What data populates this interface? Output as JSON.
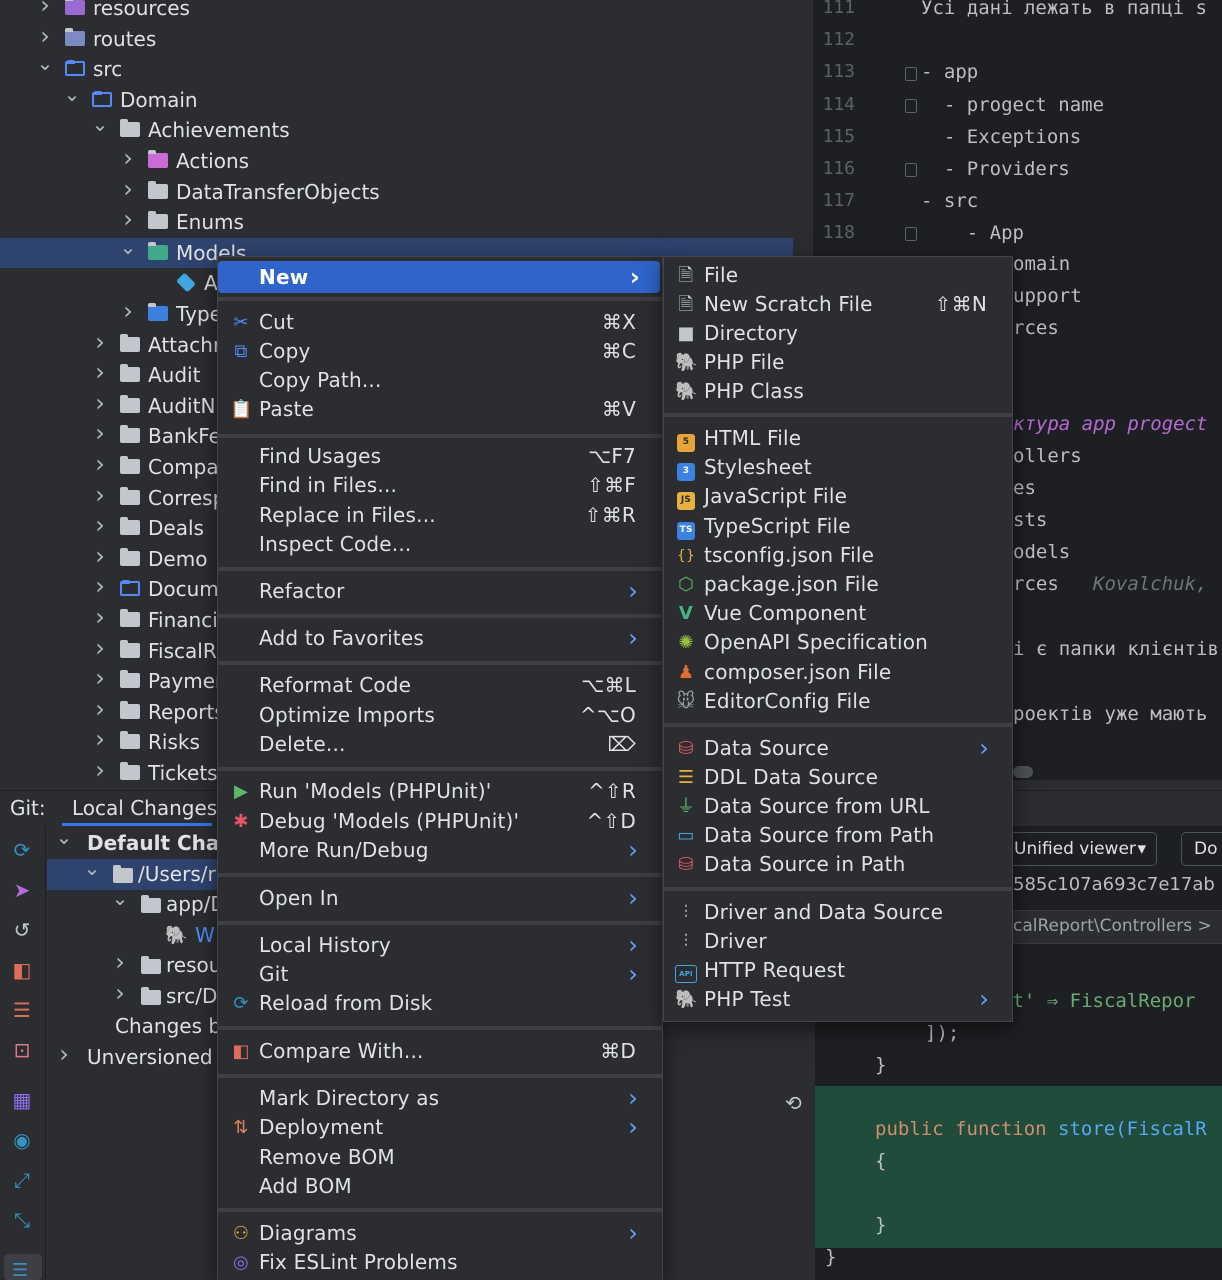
{
  "tree": {
    "items": [
      {
        "label": "resources",
        "depth": 1,
        "chev": "›",
        "icon": "resources-folder"
      },
      {
        "label": "routes",
        "depth": 1,
        "chev": "›",
        "icon": "routes-folder"
      },
      {
        "label": "src",
        "depth": 1,
        "chev": "⌄",
        "icon": "source-folder"
      },
      {
        "label": "Domain",
        "depth": 2,
        "chev": "⌄",
        "icon": "folder-outline"
      },
      {
        "label": "Achievements",
        "depth": 3,
        "chev": "⌄",
        "icon": "folder"
      },
      {
        "label": "Actions",
        "depth": 4,
        "chev": "›",
        "icon": "actions-folder"
      },
      {
        "label": "DataTransferObjects",
        "depth": 4,
        "chev": "›",
        "icon": "folder"
      },
      {
        "label": "Enums",
        "depth": 4,
        "chev": "›",
        "icon": "folder"
      },
      {
        "label": "Models",
        "depth": 4,
        "chev": "⌄",
        "icon": "models-folder"
      },
      {
        "label": "A",
        "depth": 5,
        "chev": "",
        "icon": "class-cube"
      },
      {
        "label": "Type",
        "depth": 4,
        "chev": "›",
        "icon": "ts-folder"
      },
      {
        "label": "Attachr",
        "depth": 3,
        "chev": "›",
        "icon": "folder"
      },
      {
        "label": "Audit",
        "depth": 3,
        "chev": "›",
        "icon": "folder"
      },
      {
        "label": "AuditN",
        "depth": 3,
        "chev": "›",
        "icon": "folder"
      },
      {
        "label": "BankFe",
        "depth": 3,
        "chev": "›",
        "icon": "folder"
      },
      {
        "label": "Compa",
        "depth": 3,
        "chev": "›",
        "icon": "folder"
      },
      {
        "label": "Corresp",
        "depth": 3,
        "chev": "›",
        "icon": "folder"
      },
      {
        "label": "Deals",
        "depth": 3,
        "chev": "›",
        "icon": "folder"
      },
      {
        "label": "Demo",
        "depth": 3,
        "chev": "›",
        "icon": "folder"
      },
      {
        "label": "Docum",
        "depth": 3,
        "chev": "›",
        "icon": "folder-outline"
      },
      {
        "label": "Financi",
        "depth": 3,
        "chev": "›",
        "icon": "folder"
      },
      {
        "label": "FiscalR",
        "depth": 3,
        "chev": "›",
        "icon": "folder"
      },
      {
        "label": "Paymer",
        "depth": 3,
        "chev": "›",
        "icon": "folder"
      },
      {
        "label": "Reports",
        "depth": 3,
        "chev": "›",
        "icon": "folder"
      },
      {
        "label": "Risks",
        "depth": 3,
        "chev": "›",
        "icon": "folder"
      },
      {
        "label": "Tickets",
        "depth": 3,
        "chev": "›",
        "icon": "folder"
      }
    ]
  },
  "editor": {
    "lines": [
      {
        "num": "111",
        "text": "Усі дані лежать в папці s"
      },
      {
        "num": "112",
        "text": ""
      },
      {
        "num": "113",
        "text": "- app"
      },
      {
        "num": "114",
        "text": "  - progect name"
      },
      {
        "num": "115",
        "text": "  - Exceptions"
      },
      {
        "num": "116",
        "text": "  - Providers"
      },
      {
        "num": "117",
        "text": "- src"
      },
      {
        "num": "118",
        "text": "    - App"
      }
    ],
    "fragments": [
      {
        "text": "omain"
      },
      {
        "text": "upport"
      },
      {
        "text": "rces"
      },
      {
        "text": "ктура app progect"
      },
      {
        "text": "ollers"
      },
      {
        "text": "es"
      },
      {
        "text": "sts"
      },
      {
        "text": "odels"
      },
      {
        "text": "rces"
      },
      {
        "text": "Kovalchuk,"
      },
      {
        "text": "і є папки клієнтів"
      },
      {
        "text": "роектів уже мають"
      }
    ]
  },
  "git": {
    "label": "Git:",
    "tab": "Local Changes",
    "changes": [
      {
        "label": "Default Chan",
        "chev": "⌄",
        "bold": true
      },
      {
        "label": "/Users/r",
        "chev": "⌄"
      },
      {
        "label": "app/D",
        "chev": "⌄"
      },
      {
        "label": "W",
        "chev": ""
      },
      {
        "label": "resou",
        "chev": "›"
      },
      {
        "label": "src/D",
        "chev": "›"
      },
      {
        "label": "Changes by ri",
        "chev": ""
      },
      {
        "label": "Unversioned F",
        "chev": "›"
      }
    ],
    "viewer": "Unified viewer",
    "do_button": "Do",
    "hash": "585c107a693c7e17ab",
    "breadcrumb": "calReport\\Controllers >",
    "diff_code": [
      {
        "text": "st' ⇒ FiscalRepor"
      },
      {
        "text": "]);"
      },
      {
        "text": "}"
      },
      {
        "text": "public function store(FiscalR"
      },
      {
        "text": "{"
      },
      {
        "text": "}"
      },
      {
        "text": "}"
      }
    ]
  },
  "context_menu": {
    "items": [
      {
        "label": "New",
        "shortcut": "",
        "arrow": true,
        "highlight": true,
        "icon": ""
      },
      {
        "label": "Cut",
        "shortcut": "⌘X",
        "icon": "scissors-icon"
      },
      {
        "label": "Copy",
        "shortcut": "⌘C",
        "icon": "copy-icon"
      },
      {
        "label": "Copy Path...",
        "shortcut": "",
        "icon": ""
      },
      {
        "label": "Paste",
        "shortcut": "⌘V",
        "icon": "clipboard-icon"
      },
      {
        "label": "Find Usages",
        "shortcut": "⌥F7",
        "icon": ""
      },
      {
        "label": "Find in Files...",
        "shortcut": "⇧⌘F",
        "icon": ""
      },
      {
        "label": "Replace in Files...",
        "shortcut": "⇧⌘R",
        "icon": ""
      },
      {
        "label": "Inspect Code...",
        "shortcut": "",
        "icon": ""
      },
      {
        "label": "Refactor",
        "arrow": true,
        "icon": ""
      },
      {
        "label": "Add to Favorites",
        "arrow": true,
        "icon": ""
      },
      {
        "label": "Reformat Code",
        "shortcut": "⌥⌘L",
        "icon": ""
      },
      {
        "label": "Optimize Imports",
        "shortcut": "^⌥O",
        "icon": ""
      },
      {
        "label": "Delete...",
        "shortcut": "⌦",
        "icon": ""
      },
      {
        "label": "Run 'Models (PHPUnit)'",
        "shortcut": "^⇧R",
        "icon": "run-icon"
      },
      {
        "label": "Debug 'Models (PHPUnit)'",
        "shortcut": "^⇧D",
        "icon": "debug-icon"
      },
      {
        "label": "More Run/Debug",
        "arrow": true,
        "icon": ""
      },
      {
        "label": "Open In",
        "arrow": true,
        "icon": ""
      },
      {
        "label": "Local History",
        "arrow": true,
        "icon": ""
      },
      {
        "label": "Git",
        "arrow": true,
        "icon": ""
      },
      {
        "label": "Reload from Disk",
        "icon": "reload-icon"
      },
      {
        "label": "Compare With...",
        "shortcut": "⌘D",
        "icon": "compare-icon"
      },
      {
        "label": "Mark Directory as",
        "arrow": true,
        "icon": ""
      },
      {
        "label": "Deployment",
        "arrow": true,
        "icon": "deployment-icon"
      },
      {
        "label": "Remove BOM",
        "icon": ""
      },
      {
        "label": "Add BOM",
        "icon": ""
      },
      {
        "label": "Diagrams",
        "arrow": true,
        "icon": "diagrams-icon"
      },
      {
        "label": "Fix ESLint Problems",
        "icon": "eslint-icon"
      }
    ]
  },
  "new_submenu": {
    "items": [
      {
        "label": "File",
        "icon": "file-icon"
      },
      {
        "label": "New Scratch File",
        "shortcut": "⇧⌘N",
        "icon": "scratch-file-icon"
      },
      {
        "label": "Directory",
        "icon": "directory-icon"
      },
      {
        "label": "PHP File",
        "icon": "php-elephant-icon"
      },
      {
        "label": "PHP Class",
        "icon": "php-elephant-icon"
      },
      {
        "label": "HTML File",
        "icon": "html5-icon"
      },
      {
        "label": "Stylesheet",
        "icon": "css3-icon"
      },
      {
        "label": "JavaScript File",
        "icon": "js-icon"
      },
      {
        "label": "TypeScript File",
        "icon": "ts-icon"
      },
      {
        "label": "tsconfig.json File",
        "icon": "tsconfig-icon"
      },
      {
        "label": "package.json File",
        "icon": "nodejs-icon"
      },
      {
        "label": "Vue Component",
        "icon": "vue-icon"
      },
      {
        "label": "OpenAPI Specification",
        "icon": "openapi-icon"
      },
      {
        "label": "composer.json File",
        "icon": "composer-icon"
      },
      {
        "label": "EditorConfig File",
        "icon": "editorconfig-icon"
      },
      {
        "label": "Data Source",
        "arrow": true,
        "icon": "database-icon"
      },
      {
        "label": "DDL Data Source",
        "icon": "ddl-icon"
      },
      {
        "label": "Data Source from URL",
        "icon": "plug-icon"
      },
      {
        "label": "Data Source from Path",
        "icon": "folder-outline-icon"
      },
      {
        "label": "Data Source in Path",
        "icon": "database-icon"
      },
      {
        "label": "Driver and Data Source",
        "icon": "driver-icon"
      },
      {
        "label": "Driver",
        "icon": "driver-icon"
      },
      {
        "label": "HTTP Request",
        "icon": "api-icon"
      },
      {
        "label": "PHP Test",
        "arrow": true,
        "icon": "php-test-icon"
      }
    ]
  },
  "colors": {
    "highlight": "#2f65ca",
    "menu_bg": "#2b2d30",
    "editor_bg": "#1e1f22",
    "diff_added": "#1f4c3b",
    "keyword": "#cf8e6d",
    "function": "#56a8f5"
  }
}
